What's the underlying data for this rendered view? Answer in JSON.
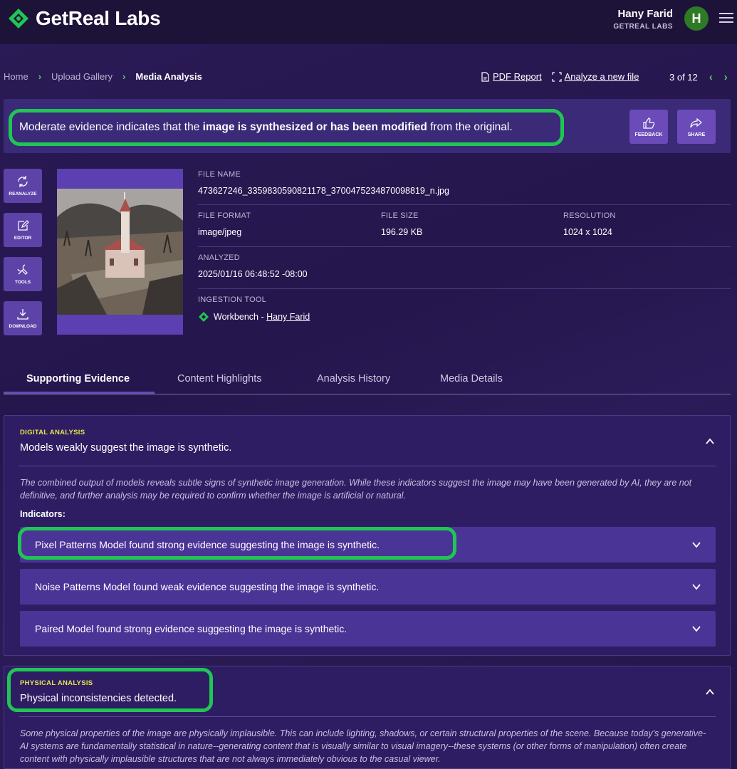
{
  "header": {
    "brand": "GetReal Labs",
    "user_name": "Hany Farid",
    "user_org": "GETREAL LABS",
    "avatar_initial": "H"
  },
  "breadcrumb": [
    "Home",
    "Upload Gallery",
    "Media Analysis"
  ],
  "toolbar": {
    "pdf_report": "PDF Report",
    "analyze_new": "Analyze a new file",
    "pager": "3 of 12"
  },
  "banner": {
    "text_before": "Moderate evidence indicates that the ",
    "text_bold": "image is synthesized or has been modified",
    "text_after": " from the original.",
    "feedback_label": "FEEDBACK",
    "share_label": "SHARE"
  },
  "side_actions": {
    "reanalyze": "REANALYZE",
    "editor": "EDITOR",
    "tools": "TOOLS",
    "download": "DOWNLOAD"
  },
  "file": {
    "name_label": "FILE NAME",
    "name": "473627246_3359830590821178_3700475234870098819_n.jpg",
    "format_label": "FILE FORMAT",
    "format": "image/jpeg",
    "size_label": "FILE SIZE",
    "size": "196.29 KB",
    "resolution_label": "RESOLUTION",
    "resolution": "1024 x 1024",
    "analyzed_label": "ANALYZED",
    "analyzed": "2025/01/16 06:48:52 -08:00",
    "tool_label": "INGESTION TOOL",
    "tool": "Workbench - ",
    "tool_user": "Hany Farid"
  },
  "tabs": [
    "Supporting Evidence",
    "Content Highlights",
    "Analysis History",
    "Media Details"
  ],
  "digital": {
    "caption": "DIGITAL ANALYSIS",
    "title": "Models weakly suggest the image is synthetic.",
    "description": "The combined output of models reveals subtle signs of synthetic image generation. While these indicators suggest the image may have been generated by AI, they are not definitive, and further analysis may be required to confirm whether the image is artificial or natural.",
    "indicators_label": "Indicators:",
    "indicators": [
      "Pixel Patterns Model found strong evidence suggesting the image is synthetic.",
      "Noise Patterns Model found weak evidence suggesting the image is synthetic.",
      "Paired Model found strong evidence suggesting the image is synthetic."
    ]
  },
  "physical": {
    "caption": "PHYSICAL ANALYSIS",
    "title": "Physical inconsistencies detected.",
    "description": "Some physical properties of the image are physically implausible. This can include lighting, shadows, or certain structural properties of the scene. Because today's generative-AI systems are fundamentally statistical in nature--generating content that is visually similar to visual imagery--these systems (or other forms of manipulation) often create content with physically implausible structures that are not always immediately obvious to the casual viewer."
  },
  "colors": {
    "accent_green": "#21c554",
    "panel": "#2e1d63",
    "button": "#6a4bb8",
    "caption_yellow": "#e6e34d"
  }
}
